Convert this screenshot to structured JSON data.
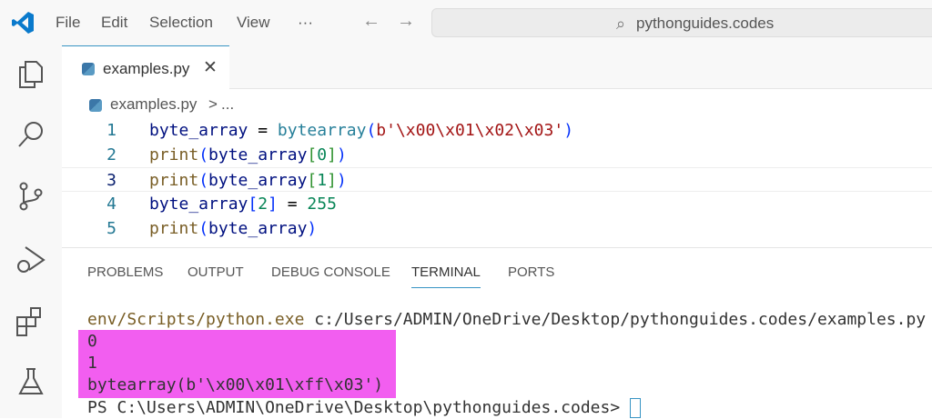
{
  "menu": {
    "file": "File",
    "edit": "Edit",
    "selection": "Selection",
    "view": "View",
    "more": "···"
  },
  "search": {
    "text": "pythonguides.codes"
  },
  "tab": {
    "label": "examples.py",
    "close": "✕"
  },
  "breadcrumb": {
    "file": "examples.py",
    "sep": ">",
    "more": "..."
  },
  "code": {
    "lines": [
      {
        "num": "1"
      },
      {
        "num": "2"
      },
      {
        "num": "3"
      },
      {
        "num": "4"
      },
      {
        "num": "5"
      }
    ],
    "t": {
      "byte_array": "byte_array",
      "eq": " = ",
      "bytearray": "bytearray",
      "lp": "(",
      "rp": ")",
      "bytes": "b'\\x00\\x01\\x02\\x03'",
      "print": "print",
      "lb": "[",
      "rb": "]",
      "i0": "0",
      "i1": "1",
      "i2": "2",
      "v255": "255"
    }
  },
  "panel": {
    "tabs": [
      "PROBLEMS",
      "OUTPUT",
      "DEBUG CONSOLE",
      "TERMINAL",
      "PORTS"
    ],
    "active": "TERMINAL"
  },
  "terminal": {
    "exe": "env/Scripts/python.exe",
    "cmd": " c:/Users/ADMIN/OneDrive/Desktop/pythonguides.codes/examples.py",
    "out": [
      "0",
      "1",
      "bytearray(b'\\x00\\x01\\xff\\x03')"
    ],
    "prompt": "PS C:\\Users\\ADMIN\\OneDrive\\Desktop\\pythonguides.codes> "
  },
  "colors": {
    "highlight": "#f25ef0",
    "accent": "#3794c4"
  }
}
